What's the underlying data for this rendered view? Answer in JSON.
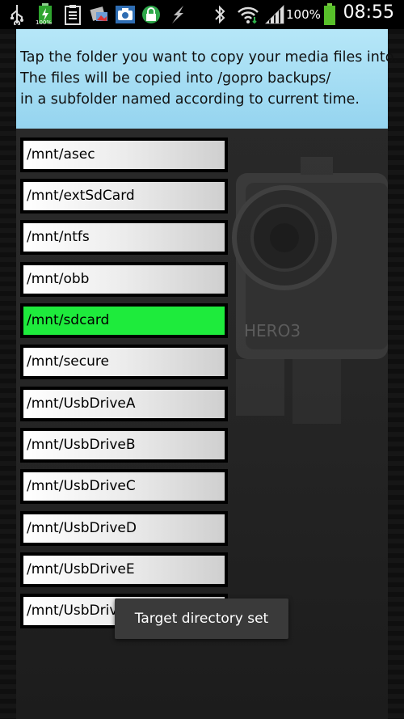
{
  "status_bar": {
    "time": "08:55",
    "battery_percent": "100%",
    "icons": [
      "usb-icon",
      "battery-charging-icon",
      "clipboard-icon",
      "image-icon",
      "camera-icon",
      "lock-icon",
      "lightning-icon",
      "bluetooth-icon",
      "wifi-icon",
      "signal-icon",
      "battery-icon"
    ],
    "battery_small_label": "100%"
  },
  "header": {
    "lines": [
      "Tap the folder you want to copy your media files into.",
      "The files will be copied into /gopro backups/",
      "in a subfolder named according to current time."
    ],
    "background": "#9fd9f1"
  },
  "folders": [
    {
      "label": "/mnt/asec"
    },
    {
      "label": "/mnt/extSdCard"
    },
    {
      "label": "/mnt/ntfs"
    },
    {
      "label": "/mnt/obb"
    },
    {
      "label": "/mnt/sdcard",
      "selected": true
    },
    {
      "label": "/mnt/secure"
    },
    {
      "label": "/mnt/UsbDriveA"
    },
    {
      "label": "/mnt/UsbDriveB"
    },
    {
      "label": "/mnt/UsbDriveC"
    },
    {
      "label": "/mnt/UsbDriveD"
    },
    {
      "label": "/mnt/UsbDriveE"
    },
    {
      "label": "/mnt/UsbDriveF"
    }
  ],
  "selected_color": "#1eeb3c",
  "camera_badge": "HERO3",
  "toast": "Target directory set"
}
